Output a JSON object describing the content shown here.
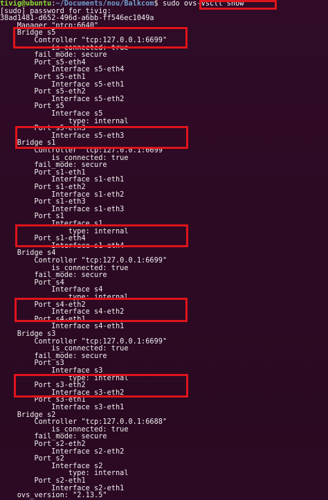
{
  "prompt": {
    "user_host": "tivig@ubuntu",
    "sep": ":",
    "path": "~/Documents/nou/Balkcom",
    "dollar": "$ sudo ",
    "command": "ovs-vsctl show"
  },
  "lines": [
    "[sudo] password for tivig:",
    "38ad1481-d652-496d-a6bb-ff546ec1049a",
    "    Manager \"ptcp:6640\"",
    "    Bridge s5",
    "        Controller \"tcp:127.0.0.1:6699\"",
    "            is_connected: true",
    "        fail_mode: secure",
    "        Port s5-eth4",
    "            Interface s5-eth4",
    "        Port s5-eth1",
    "            Interface s5-eth1",
    "        Port s5-eth2",
    "            Interface s5-eth2",
    "        Port s5",
    "            Interface s5",
    "                type: internal",
    "        Port s5-eth3",
    "            Interface s5-eth3",
    "    Bridge s1",
    "        Controller \"tcp:127.0.0.1:6699\"",
    "            is_connected: true",
    "        fail_mode: secure",
    "        Port s1-eth1",
    "            Interface s1-eth1",
    "        Port s1-eth2",
    "            Interface s1-eth2",
    "        Port s1-eth3",
    "            Interface s1-eth3",
    "        Port s1",
    "            Interface s1",
    "                type: internal",
    "        Port s1-eth4",
    "            Interface s1-eth4",
    "    Bridge s4",
    "        Controller \"tcp:127.0.0.1:6699\"",
    "            is_connected: true",
    "        fail_mode: secure",
    "        Port s4",
    "            Interface s4",
    "                type: internal",
    "        Port s4-eth2",
    "            Interface s4-eth2",
    "        Port s4-eth1",
    "            Interface s4-eth1",
    "    Bridge s3",
    "        Controller \"tcp:127.0.0.1:6699\"",
    "            is_connected: true",
    "        fail_mode: secure",
    "        Port s3",
    "            Interface s3",
    "                type: internal",
    "        Port s3-eth2",
    "            Interface s3-eth2",
    "        Port s3-eth1",
    "            Interface s3-eth1",
    "    Bridge s2",
    "        Controller \"tcp:127.0.0.1:6688\"",
    "            is_connected: true",
    "        fail_mode: secure",
    "        Port s2-eth2",
    "            Interface s2-eth2",
    "        Port s2",
    "            Interface s2",
    "                type: internal",
    "        Port s2-eth1",
    "            Interface s2-eth1",
    "    ovs_version: \"2.13.5\""
  ],
  "highlight_color": "#e0141b"
}
